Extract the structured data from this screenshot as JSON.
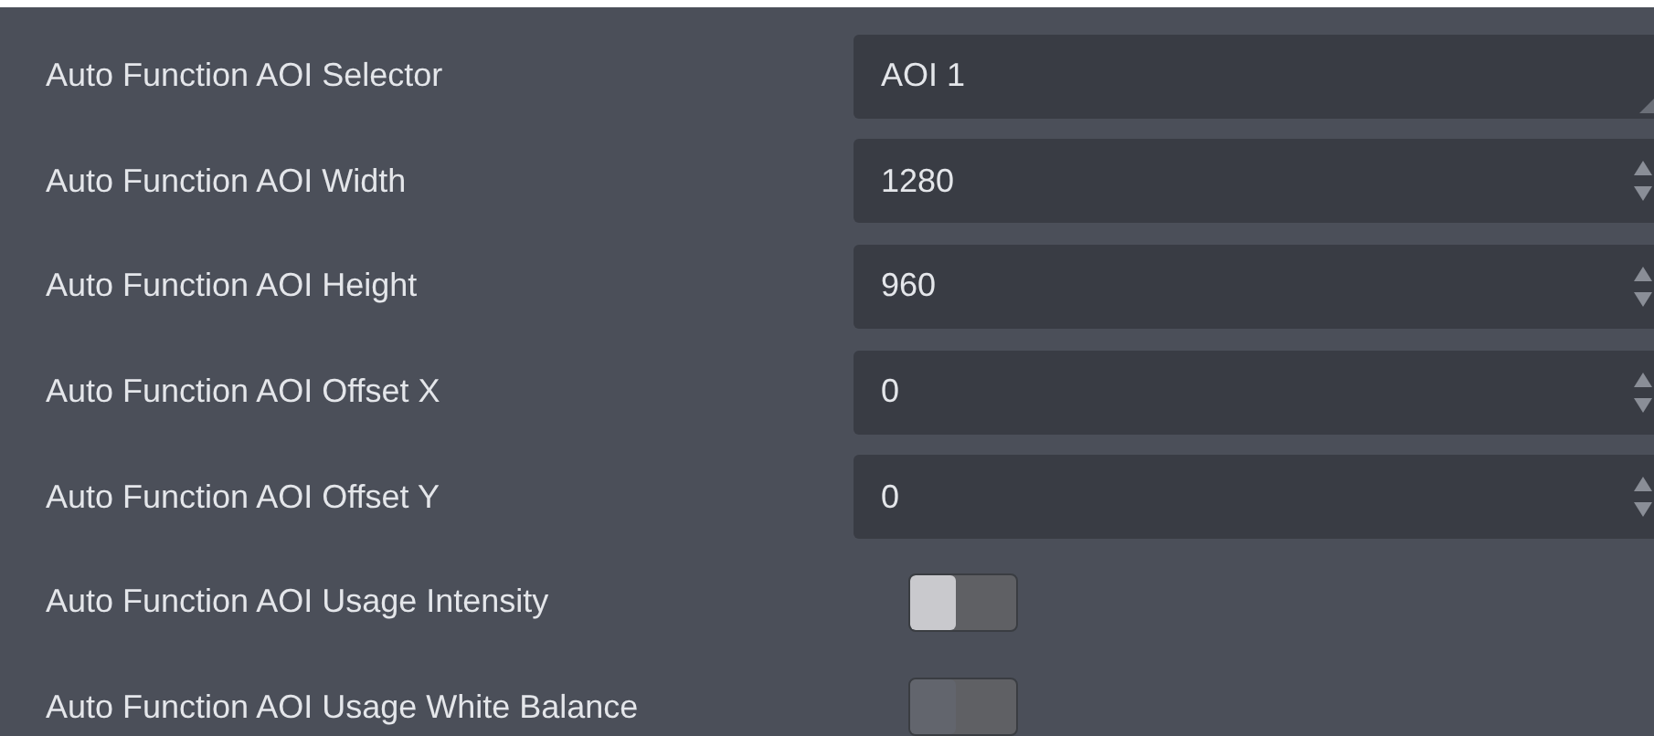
{
  "rows": [
    {
      "label": "Auto Function AOI Selector",
      "kind": "select",
      "value": "AOI 1"
    },
    {
      "label": "Auto Function AOI Width",
      "kind": "spin",
      "value": "1280"
    },
    {
      "label": "Auto Function AOI Height",
      "kind": "spin",
      "value": "960"
    },
    {
      "label": "Auto Function AOI Offset X",
      "kind": "spin",
      "value": "0"
    },
    {
      "label": "Auto Function AOI Offset Y",
      "kind": "spin",
      "value": "0"
    },
    {
      "label": "Auto Function AOI Usage Intensity",
      "kind": "toggle",
      "on": false,
      "disabled": false
    },
    {
      "label": "Auto Function AOI Usage White Balance",
      "kind": "toggle",
      "on": false,
      "disabled": true
    }
  ]
}
